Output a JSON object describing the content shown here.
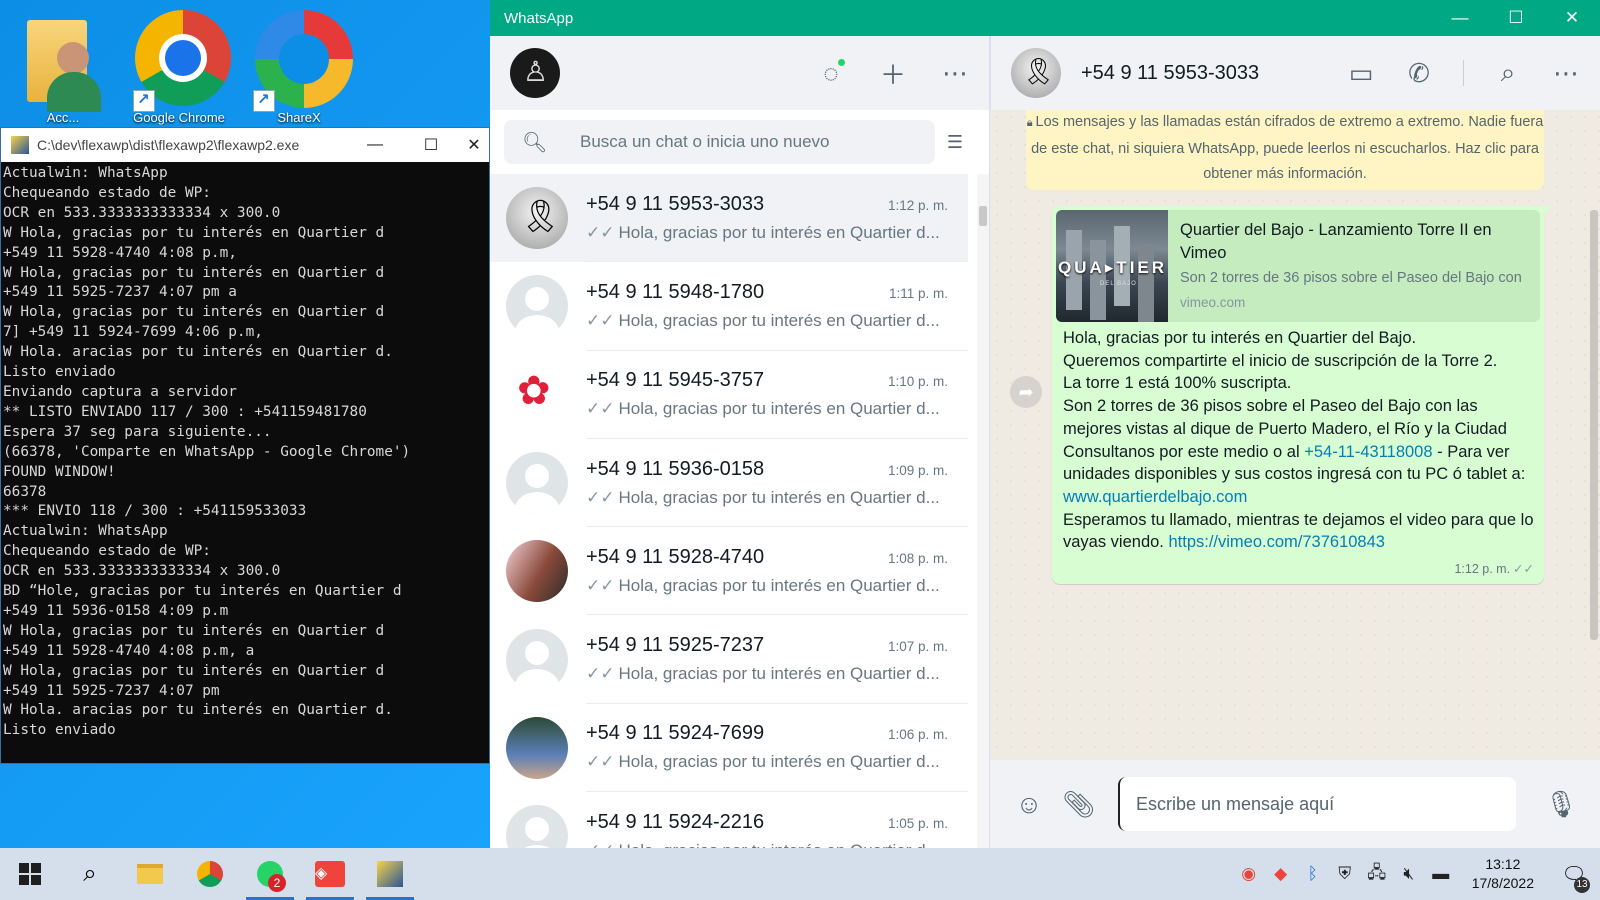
{
  "desktop": {
    "icons": [
      {
        "label": "Acc...",
        "icon": "user-folder-icon"
      },
      {
        "label": "Google Chrome",
        "icon": "chrome-icon"
      },
      {
        "label": "ShareX",
        "icon": "sharex-icon"
      }
    ]
  },
  "console": {
    "title": "C:\\dev\\flexawp\\dist\\flexawp2\\flexawp2.exe",
    "lines": [
      "Actualwin: WhatsApp",
      "Chequeando estado de WP:",
      "OCR en 533.3333333333334 x 300.0",
      "W Hola, gracias por tu interés en Quartier d",
      "+549 11 5928-4740 4:08 p.m,",
      "W Hola, gracias por tu interés en Quartier d",
      "+549 11 5925-7237 4:07 pm a",
      "W Hola, gracias por tu interés en Quartier d",
      "7] +549 11 5924-7699 4:06 p.m,",
      "W Hola. aracias por tu interés en Quartier d.",
      "Listo enviado",
      "Enviando captura a servidor",
      "** LISTO ENVIADO 117 / 300 : +541159481780",
      "Espera 37 seg para siguiente...",
      "(66378, 'Comparte en WhatsApp - Google Chrome')",
      "FOUND WINDOW!",
      "66378",
      "*** ENVIO 118 / 300 : +541159533033",
      "Actualwin: WhatsApp",
      "Chequeando estado de WP:",
      "OCR en 533.3333333333334 x 300.0",
      "BD “Hole, gracias por tu interés en Quartier d",
      "+549 11 5936-0158 4:09 p.m",
      "W Hola, gracias por tu interés en Quartier d",
      "+549 11 5928-4740 4:08 p.m, a",
      "W Hola, gracias por tu interés en Quartier d",
      "+549 11 5925-7237 4:07 pm",
      "W Hola. aracias por tu interés en Quartier d.",
      "Listo enviado"
    ]
  },
  "whatsapp": {
    "window_title": "WhatsApp",
    "search_placeholder": "Busca un chat o inicia uno nuevo",
    "chats": [
      {
        "name": "+54 9 11 5953-3033",
        "time": "1:12 p. m.",
        "preview": "Hola, gracias por tu interés en Quartier d...",
        "avatar": "ribbon",
        "active": true
      },
      {
        "name": "+54 9 11 5948-1780",
        "time": "1:11 p. m.",
        "preview": "Hola, gracias por tu interés en Quartier d...",
        "avatar": "default",
        "active": false
      },
      {
        "name": "+54 9 11 5945-3757",
        "time": "1:10 p. m.",
        "preview": "Hola, gracias por tu interés en Quartier d...",
        "avatar": "flower",
        "active": false
      },
      {
        "name": "+54 9 11 5936-0158",
        "time": "1:09 p. m.",
        "preview": "Hola, gracias por tu interés en Quartier d...",
        "avatar": "default",
        "active": false
      },
      {
        "name": "+54 9 11 5928-4740",
        "time": "1:08 p. m.",
        "preview": "Hola, gracias por tu interés en Quartier d...",
        "avatar": "couple",
        "active": false
      },
      {
        "name": "+54 9 11 5925-7237",
        "time": "1:07 p. m.",
        "preview": "Hola, gracias por tu interés en Quartier d...",
        "avatar": "default",
        "active": false
      },
      {
        "name": "+54 9 11 5924-7699",
        "time": "1:06 p. m.",
        "preview": "Hola, gracias por tu interés en Quartier d...",
        "avatar": "man",
        "active": false
      },
      {
        "name": "+54 9 11 5924-2216",
        "time": "1:05 p. m.",
        "preview": "Hola, gracias por tu interés en Quartier d...",
        "avatar": "default",
        "active": false
      }
    ],
    "conversation": {
      "contact_name": "+54 9 11 5953-3033",
      "encryption_notice": "Los mensajes y las llamadas están cifrados de extremo a extremo. Nadie fuera de este chat, ni siquiera WhatsApp, puede leerlos ni escucharlos. Haz clic para obtener más información.",
      "link_preview": {
        "title": "Quartier del Bajo - Lanzamiento Torre II en Vimeo",
        "description": "Son 2 torres de 36 pisos sobre el Paseo del Bajo con",
        "domain": "vimeo.com",
        "thumb_brand": "QUA▸TIER",
        "thumb_sub": "DEL BAJO"
      },
      "message": {
        "p1": "Hola, gracias por tu interés en Quartier del Bajo.",
        "p2": "Queremos compartirte el inicio de suscripción de la Torre 2.",
        "p3": "La torre 1 está 100% suscripta.",
        "p4": "Son 2 torres de 36 pisos sobre el Paseo del Bajo con las mejores vistas al dique de Puerto Madero, el Río y la Ciudad",
        "p5_pre": "Consultanos por este medio o al ",
        "phone_link": "+54-11-43118008",
        "p5_post": " - Para ver unidades disponibles y sus costos ingresá con tu PC ó tablet a: ",
        "site_link": "www.quartierdelbajo.com",
        "p6_pre": "Esperamos tu llamado, mientras te dejamos el video para que lo vayas viendo. ",
        "video_link": "https://vimeo.com/737610843",
        "time": "1:12 p. m."
      },
      "composer_placeholder": "Escribe un mensaje aquí"
    }
  },
  "taskbar": {
    "whatsapp_badge": "2",
    "time": "13:12",
    "date": "17/8/2022",
    "notifications": "13"
  }
}
